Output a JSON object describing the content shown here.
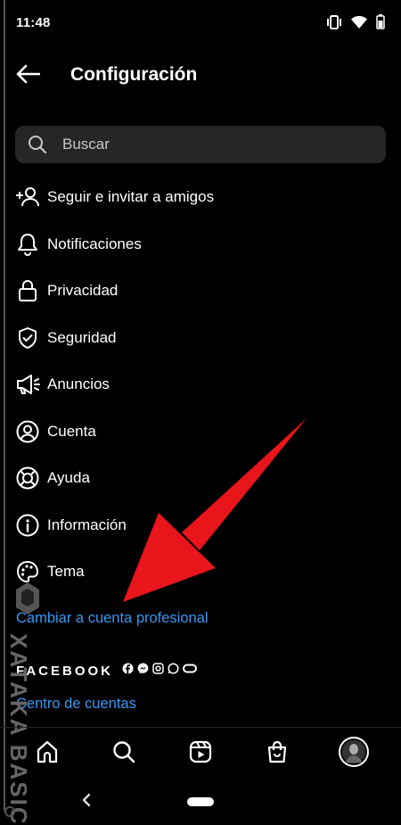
{
  "status_bar": {
    "time": "11:48"
  },
  "header": {
    "title": "Configuración"
  },
  "search": {
    "placeholder": "Buscar"
  },
  "menu": [
    {
      "label": "Seguir e invitar a amigos",
      "icon": "add-person-icon"
    },
    {
      "label": "Notificaciones",
      "icon": "bell-icon"
    },
    {
      "label": "Privacidad",
      "icon": "lock-icon"
    },
    {
      "label": "Seguridad",
      "icon": "shield-icon"
    },
    {
      "label": "Anuncios",
      "icon": "megaphone-icon"
    },
    {
      "label": "Cuenta",
      "icon": "account-circle-icon"
    },
    {
      "label": "Ayuda",
      "icon": "lifebuoy-icon"
    },
    {
      "label": "Información",
      "icon": "info-icon"
    },
    {
      "label": "Tema",
      "icon": "palette-icon"
    }
  ],
  "links": {
    "professional": "Cambiar a cuenta profesional",
    "accounts_center": "Centro de cuentas"
  },
  "facebook": {
    "label": "FACEBOOK"
  },
  "watermark": {
    "text": "XATAKA BASICS"
  },
  "colors": {
    "background": "#000000",
    "link": "#3797f0",
    "arrow": "#e8151b",
    "search_bg": "#262626"
  },
  "tabs": [
    "home-icon",
    "search-icon",
    "reels-icon",
    "shop-icon",
    "profile-avatar"
  ]
}
